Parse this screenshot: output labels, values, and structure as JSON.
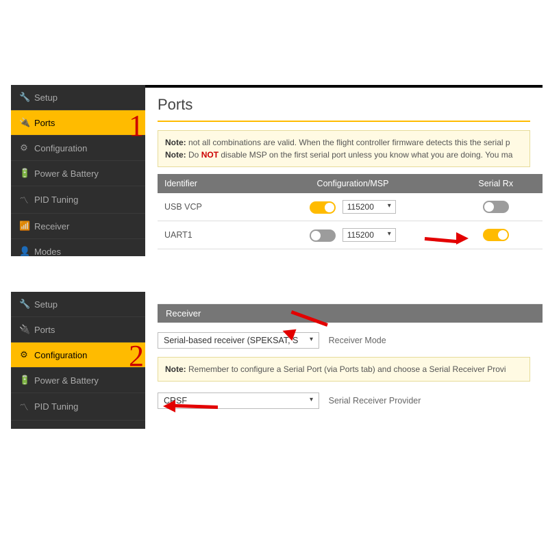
{
  "annotations": {
    "num1": "1",
    "num2": "2"
  },
  "panel1": {
    "sidebar": [
      {
        "label": "Setup",
        "icon": "🔧"
      },
      {
        "label": "Ports",
        "icon": "🔌"
      },
      {
        "label": "Configuration",
        "icon": "⚙"
      },
      {
        "label": "Power & Battery",
        "icon": "🔋"
      },
      {
        "label": "PID Tuning",
        "icon": "〽"
      },
      {
        "label": "Receiver",
        "icon": "📶"
      },
      {
        "label": "Modes",
        "icon": "👤"
      }
    ],
    "active_index": 1,
    "title": "Ports",
    "note1_prefix": "Note:",
    "note1_text": " not all combinations are valid. When the flight controller firmware detects this the serial p",
    "note2_prefix": "Note:",
    "note2_do": " Do ",
    "note2_not": "NOT",
    "note2_rest": " disable MSP on the first serial port unless you know what you are doing. You ma",
    "table": {
      "headers": [
        "Identifier",
        "Configuration/MSP",
        "Serial Rx"
      ],
      "rows": [
        {
          "id": "USB VCP",
          "msp_on": true,
          "baud": "115200",
          "rx_on": false
        },
        {
          "id": "UART1",
          "msp_on": false,
          "baud": "115200",
          "rx_on": true
        }
      ]
    }
  },
  "panel2": {
    "sidebar": [
      {
        "label": "Setup",
        "icon": "🔧"
      },
      {
        "label": "Ports",
        "icon": "🔌"
      },
      {
        "label": "Configuration",
        "icon": "⚙"
      },
      {
        "label": "Power & Battery",
        "icon": "🔋"
      },
      {
        "label": "PID Tuning",
        "icon": "〽"
      }
    ],
    "active_index": 2,
    "receiver_title": "Receiver",
    "mode_value": "Serial-based receiver (SPEKSAT, S",
    "mode_label": "Receiver Mode",
    "note_prefix": "Note:",
    "note_text": " Remember to configure a Serial Port (via Ports tab) and choose a Serial Receiver Provi",
    "provider_value": "CRSF",
    "provider_label": "Serial Receiver Provider"
  }
}
